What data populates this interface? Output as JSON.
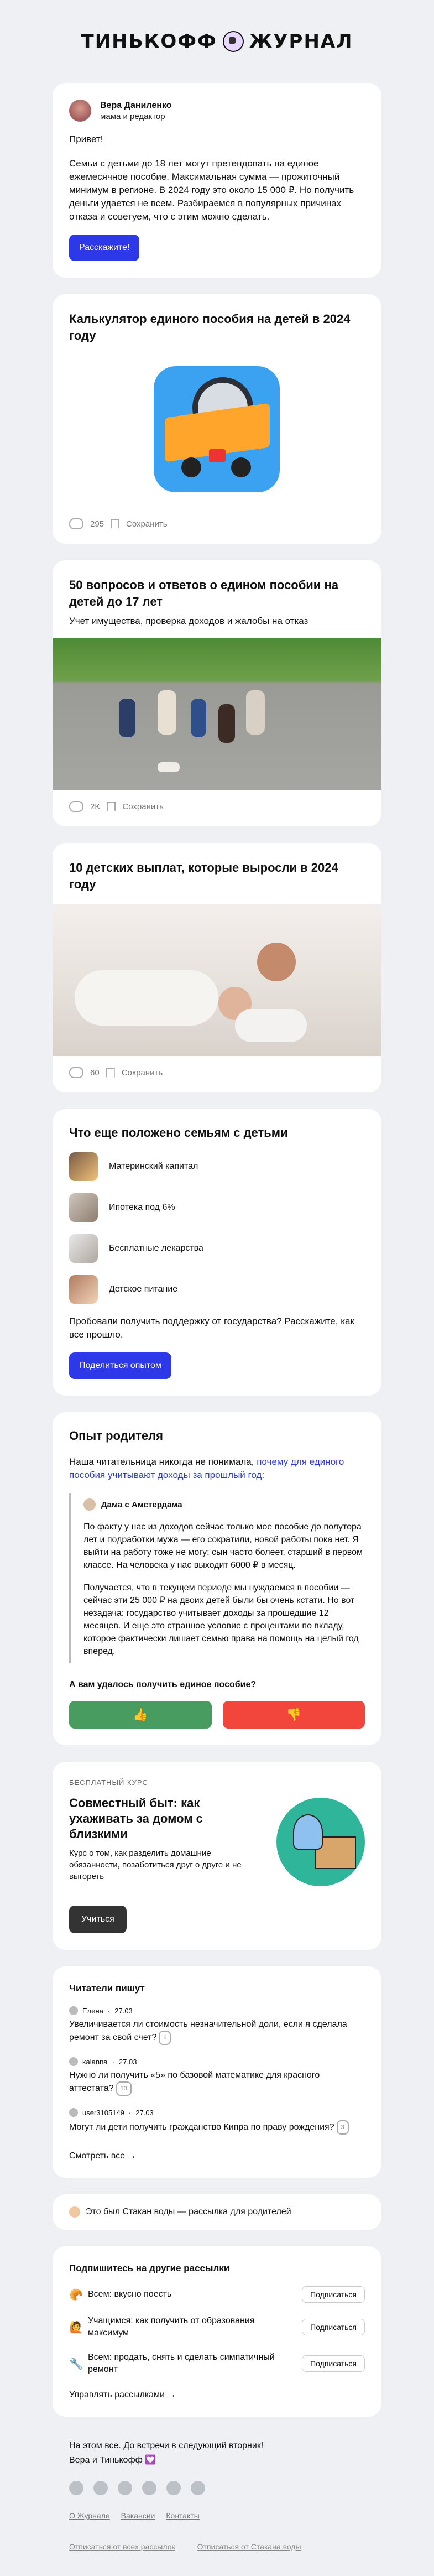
{
  "logo": {
    "left": "ТИНЬКОФФ",
    "right": "ЖУРНАЛ"
  },
  "intro": {
    "author_name": "Вера Даниленко",
    "author_role": "мама и редактор",
    "greeting": "Привет!",
    "text": "Семьи с детьми до 18 лет могут претендовать на единое ежемесячное пособие. Максимальная сумма — прожиточный минимум в регионе. В 2024 году это около 15 000 ₽. Но получить деньги удается не всем. Разбираемся в популярных причинах отказа и советуем, что с этим можно сделать.",
    "button": "Расскажите!"
  },
  "articles": [
    {
      "title": "Калькулятор единого пособия на детей в 2024 году",
      "subtitle": "",
      "comments": "295",
      "save": "Сохранить"
    },
    {
      "title": "50 вопросов и ответов о едином пособии на детей до 17 лет",
      "subtitle": "Учет имущества, проверка доходов и жалобы на отказ",
      "comments": "2K",
      "save": "Сохранить"
    },
    {
      "title": "10 детских выплат, которые выросли в 2024 году",
      "subtitle": "",
      "comments": "60",
      "save": "Сохранить"
    }
  ],
  "benefits": {
    "title": "Что еще положено семьям с детьми",
    "items": [
      "Материнский капитал",
      "Ипотека под 6%",
      "Бесплатные лекарства",
      "Детское питание"
    ],
    "text": "Пробовали получить поддержку от государства? Расскажите, как все прошло.",
    "button": "Поделиться опытом"
  },
  "experience": {
    "title": "Опыт родителя",
    "intro_before": "Наша читательница никогда не понимала, ",
    "intro_link": "почему для единого пособия учитывают доходы за прошлый год",
    "intro_after": ":",
    "quote_author": "Дама с Амстердама",
    "quote_p1": "По факту у нас из доходов сейчас только мое пособие до полутора лет и подработки мужа — его сократили, новой работы пока нет. Я выйти на работу тоже не могу: сын часто болеет, старший в первом классе. На человека у нас выходит 6000 ₽ в месяц.",
    "quote_p2": "Получается, что в текущем периоде мы нуждаемся в пособии — сейчас эти 25 000 ₽ на двоих детей были бы очень кстати. Но вот незадача: государство учитывает доходы за прошедшие 12 месяцев. И еще это странное условие с процентами по вкладу, которое фактически лишает семью права на помощь на целый год вперед.",
    "question": "А вам удалось получить единое пособие?",
    "yes": "👍",
    "no": "👎"
  },
  "course": {
    "label": "БЕСПЛАТНЫЙ КУРС",
    "title": "Совместный быт: как ухаживать за домом с близкими",
    "text": "Курс о том, как разделить домашние обязанности, позаботиться друг о друге и не выгореть",
    "button": "Учиться"
  },
  "readers": {
    "title": "Читатели пишут",
    "comments": [
      {
        "user": "Елена",
        "date": "27.03",
        "text": "Увеличивается ли стоимость незначительной доли, если я сделала ремонт за свой счет?",
        "badge": "6"
      },
      {
        "user": "kalanna",
        "date": "27.03",
        "text": "Нужно ли получить «5» по базовой математике для красного аттестата?",
        "badge": "10"
      },
      {
        "user": "user3105149",
        "date": "27.03",
        "text": "Могут ли дети получить гражданство Кипра по праву рождения?",
        "badge": "3"
      }
    ],
    "see_all": "Смотреть все →"
  },
  "newsletter_note": "Это был Стакан воды — рассылка для родителей",
  "subscriptions": {
    "title": "Подпишитесь на другие рассылки",
    "items": [
      {
        "emoji": "🥐",
        "text": "Всем: вкусно поесть",
        "button": "Подписаться"
      },
      {
        "emoji": "🙋",
        "text": "Учащимся: как получить от образования максимум",
        "button": "Подписаться"
      },
      {
        "emoji": "🔧",
        "text": "Всем: продать, снять и сделать симпатичный ремонт",
        "button": "Подписаться"
      }
    ],
    "manage": "Управлять рассылками →"
  },
  "footer": {
    "line1": "На этом все. До встречи в следующий вторник!",
    "line2": "Вера и Тинькофф 💟",
    "links": [
      "О Журнале",
      "Вакансии",
      "Контакты"
    ],
    "unsubscribe_all": "Отписаться от всех рассылок",
    "unsubscribe_one": "Отписаться от Стакана воды"
  }
}
